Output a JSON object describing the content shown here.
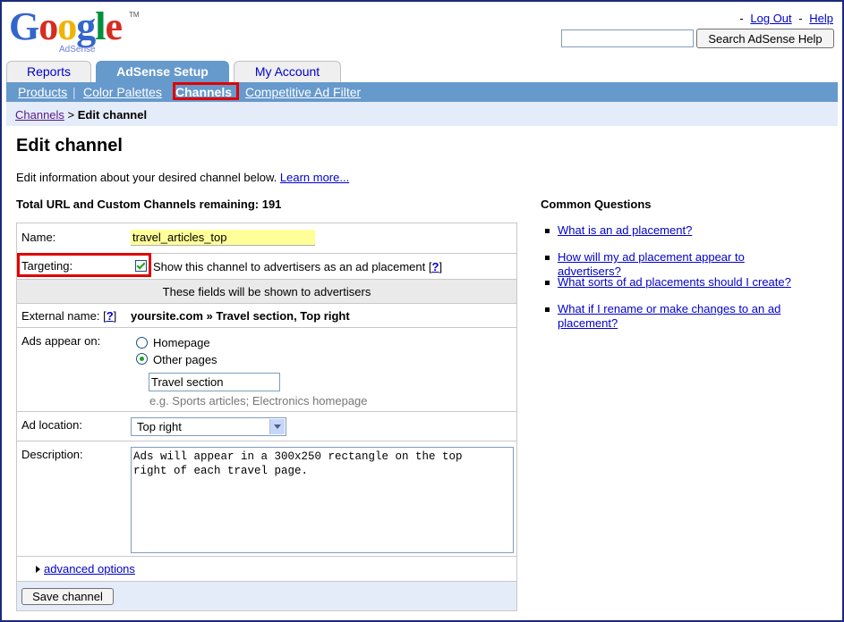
{
  "header": {
    "logo": {
      "word": "Google",
      "sub": "AdSense",
      "tm": "TM"
    },
    "dash": "-",
    "logout": "Log Out",
    "sep": "-",
    "help": "Help",
    "search_value": "",
    "search_button": "Search AdSense Help"
  },
  "tabs": [
    {
      "label": "Reports"
    },
    {
      "label": "AdSense Setup"
    },
    {
      "label": "My Account"
    }
  ],
  "subnav": {
    "items": [
      "Products",
      "Color Palettes",
      "Channels",
      "Competitive Ad Filter"
    ],
    "sep": "|"
  },
  "breadcrumb": {
    "link": "Channels",
    "separator": " > ",
    "current": "Edit channel"
  },
  "page": {
    "title": "Edit channel",
    "intro": "Edit information about your desired channel below.",
    "learn_more": "Learn more...",
    "remaining": "Total URL and Custom Channels remaining: 191"
  },
  "form": {
    "name_label": "Name:",
    "name_value": "travel_articles_top",
    "targeting_label": "Targeting:",
    "targeting_checked": true,
    "targeting_text": "Show this channel to advertisers as an ad placement",
    "q_open": "[",
    "q": "?",
    "q_close": "]",
    "shown_note": "These fields will be shown to advertisers",
    "external_label": "External name:",
    "external_value": "yoursite.com » Travel section, Top right",
    "ads_appear_label": "Ads appear on:",
    "radio_homepage": "Homepage",
    "radio_other": "Other pages",
    "other_selected": true,
    "other_value": "Travel section",
    "other_example": "e.g. Sports articles; Electronics homepage",
    "ad_location_label": "Ad location:",
    "ad_location_value": "Top right",
    "description_label": "Description:",
    "description_value": "Ads will appear in a 300x250 rectangle on the top\nright of each travel page.",
    "advanced_options": "advanced options",
    "save_button": "Save channel"
  },
  "common_questions": {
    "title": "Common Questions",
    "items": [
      "What is an ad placement?",
      "How will my ad placement appear to advertisers?",
      "What sorts of ad placements should I create?",
      "What if I rename or make changes to an ad placement?"
    ]
  }
}
